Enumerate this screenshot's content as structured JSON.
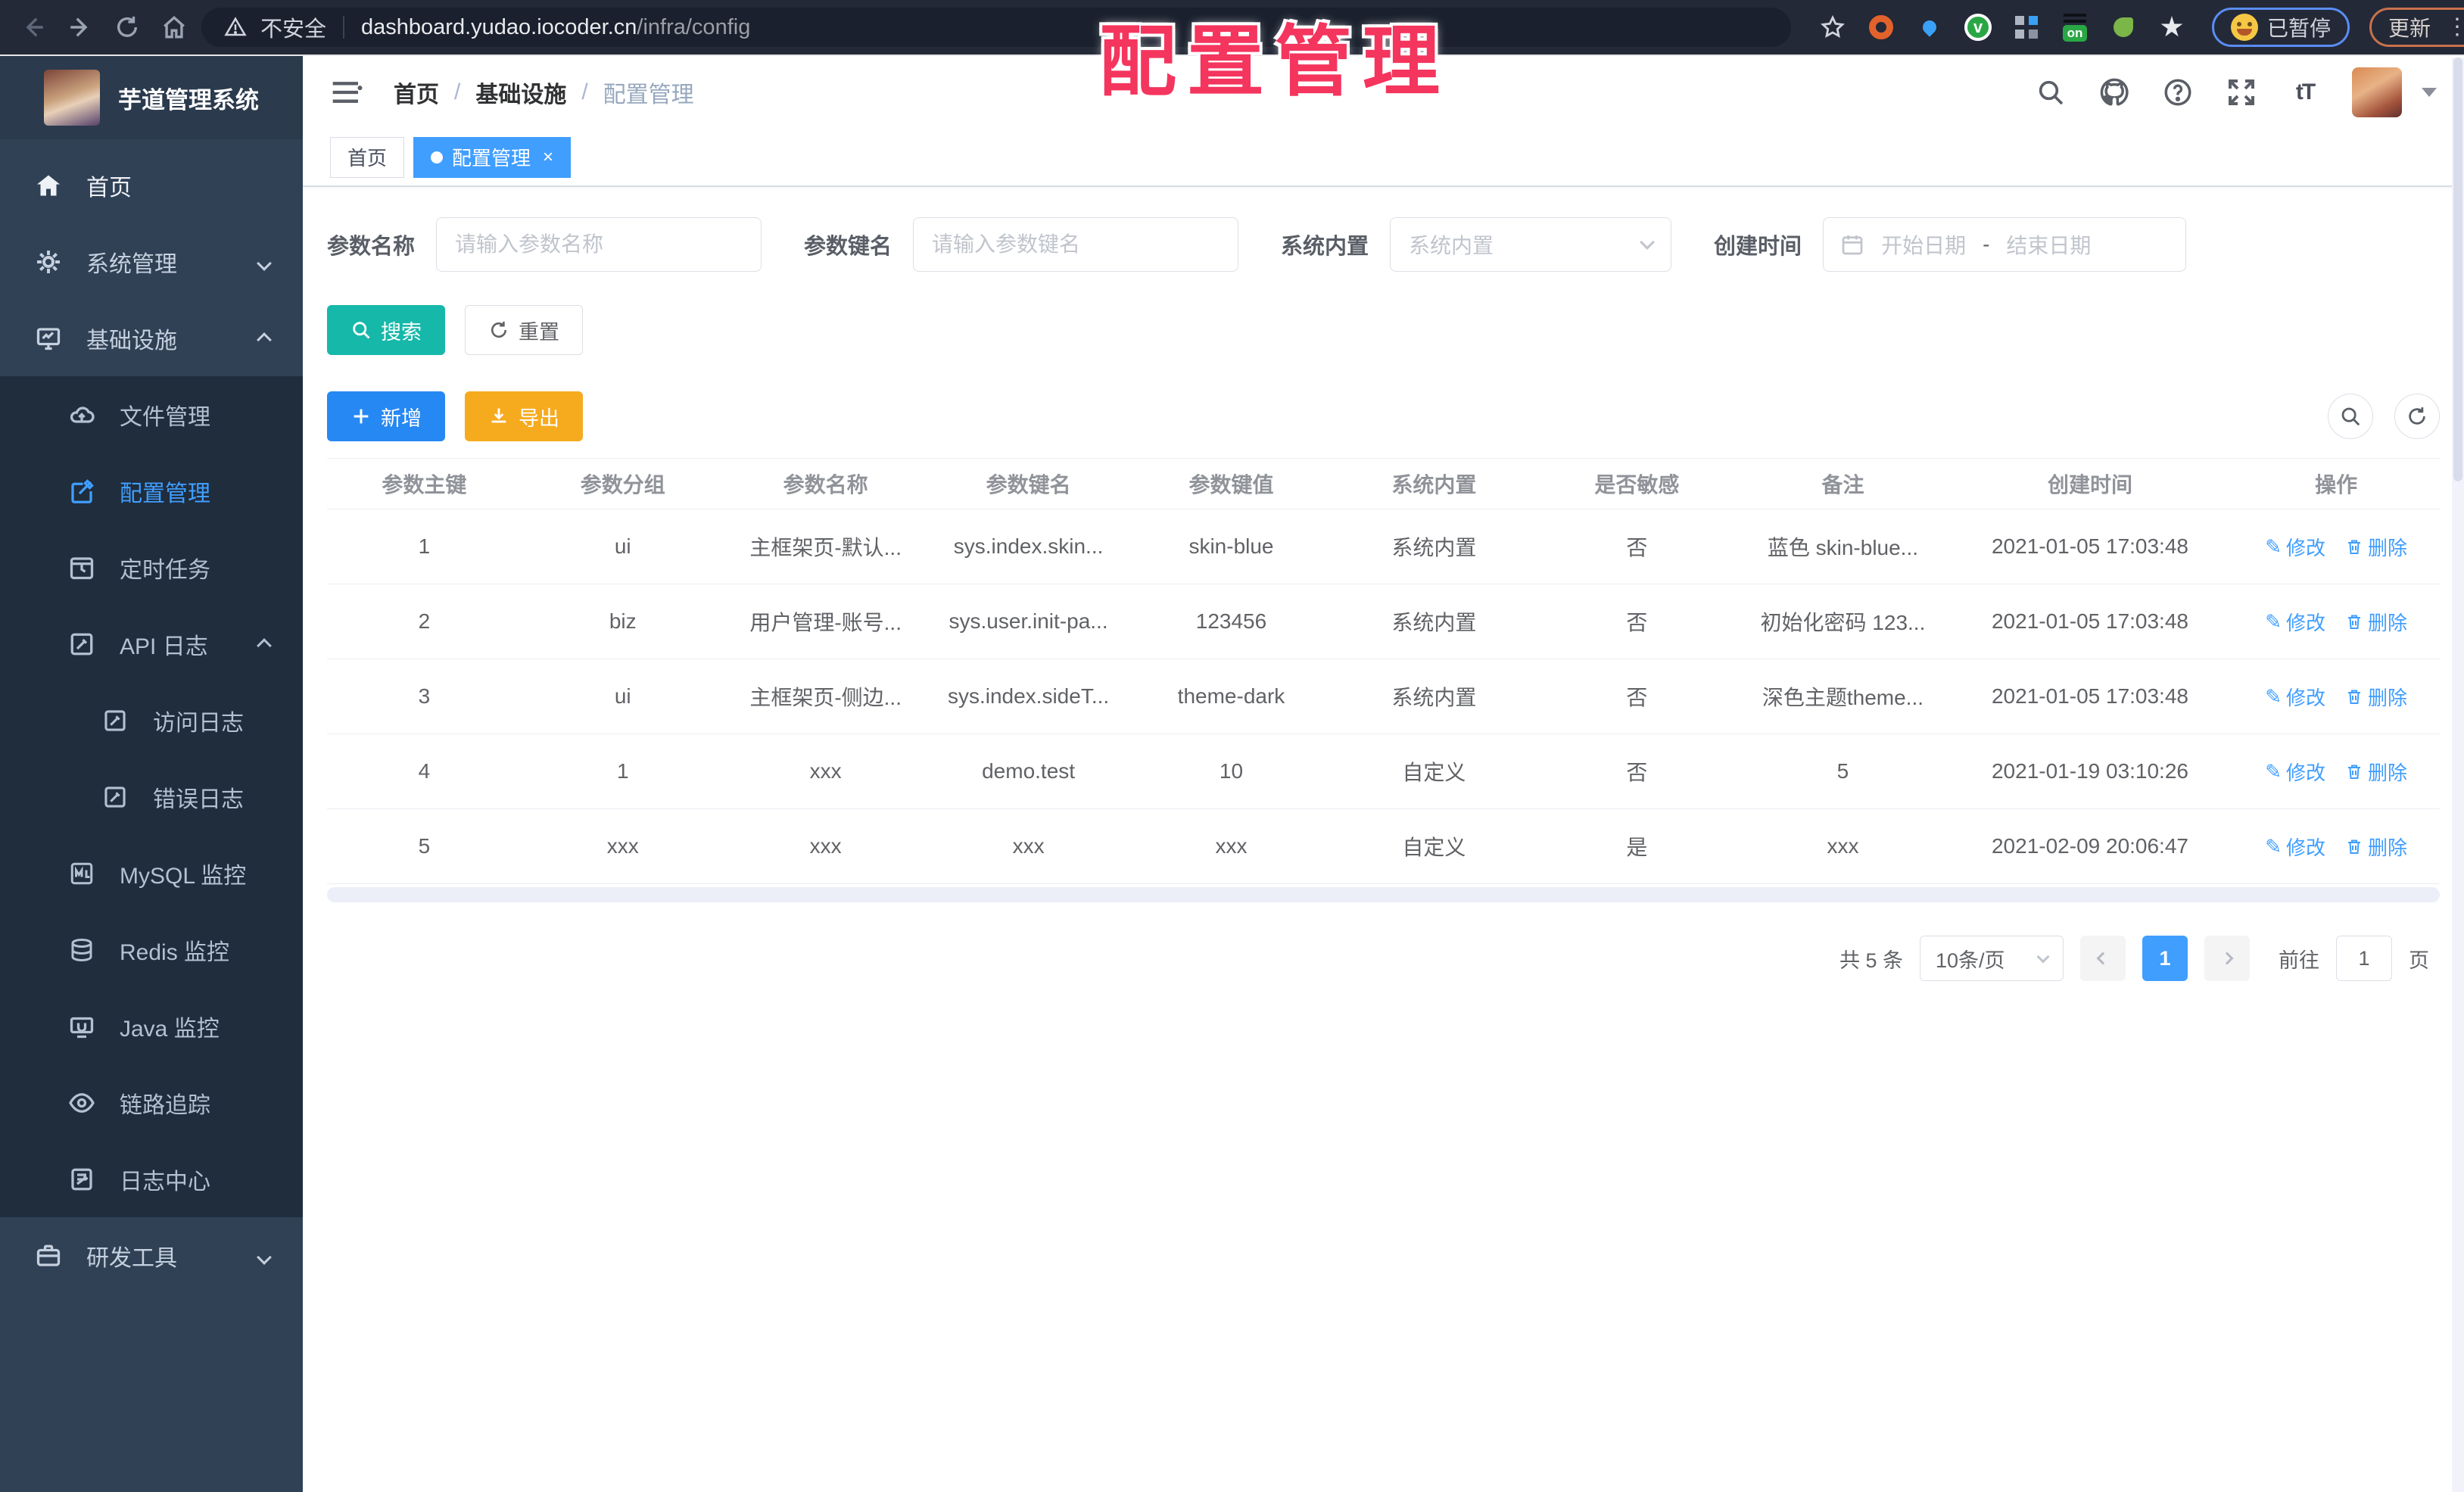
{
  "browser": {
    "security_label": "不安全",
    "url_host": "dashboard.yudao.iocoder.cn",
    "url_path": "/infra/config",
    "paused_badge": "已暂停",
    "update_button": "更新"
  },
  "overlay_title": "配置管理",
  "sidebar": {
    "app_title": "芋道管理系统",
    "items": [
      {
        "label": "首页"
      },
      {
        "label": "系统管理"
      },
      {
        "label": "基础设施"
      },
      {
        "label": "文件管理"
      },
      {
        "label": "配置管理"
      },
      {
        "label": "定时任务"
      },
      {
        "label": "API 日志"
      },
      {
        "label": "访问日志"
      },
      {
        "label": "错误日志"
      },
      {
        "label": "MySQL 监控"
      },
      {
        "label": "Redis 监控"
      },
      {
        "label": "Java 监控"
      },
      {
        "label": "链路追踪"
      },
      {
        "label": "日志中心"
      },
      {
        "label": "研发工具"
      }
    ]
  },
  "header": {
    "breadcrumb": [
      "首页",
      "基础设施",
      "配置管理"
    ]
  },
  "tabs": [
    {
      "label": "首页"
    },
    {
      "label": "配置管理",
      "close": "×"
    }
  ],
  "filters": {
    "name_label": "参数名称",
    "name_placeholder": "请输入参数名称",
    "key_label": "参数键名",
    "key_placeholder": "请输入参数键名",
    "builtin_label": "系统内置",
    "builtin_placeholder": "系统内置",
    "date_label": "创建时间",
    "date_start": "开始日期",
    "date_sep": "-",
    "date_end": "结束日期"
  },
  "toolbar": {
    "search": "搜索",
    "reset": "重置",
    "add": "新增",
    "export": "导出"
  },
  "table": {
    "columns": [
      "参数主键",
      "参数分组",
      "参数名称",
      "参数键名",
      "参数键值",
      "系统内置",
      "是否敏感",
      "备注",
      "创建时间",
      "操作"
    ],
    "rows": [
      {
        "id": "1",
        "group": "ui",
        "name": "主框架页-默认...",
        "key": "sys.index.skin...",
        "value": "skin-blue",
        "builtin": "系统内置",
        "sensitive": "否",
        "remark": "蓝色 skin-blue...",
        "created": "2021-01-05 17:03:48"
      },
      {
        "id": "2",
        "group": "biz",
        "name": "用户管理-账号...",
        "key": "sys.user.init-pa...",
        "value": "123456",
        "builtin": "系统内置",
        "sensitive": "否",
        "remark": "初始化密码 123...",
        "created": "2021-01-05 17:03:48"
      },
      {
        "id": "3",
        "group": "ui",
        "name": "主框架页-侧边...",
        "key": "sys.index.sideT...",
        "value": "theme-dark",
        "builtin": "系统内置",
        "sensitive": "否",
        "remark": "深色主题theme...",
        "created": "2021-01-05 17:03:48"
      },
      {
        "id": "4",
        "group": "1",
        "name": "xxx",
        "key": "demo.test",
        "value": "10",
        "builtin": "自定义",
        "sensitive": "否",
        "remark": "5",
        "created": "2021-01-19 03:10:26"
      },
      {
        "id": "5",
        "group": "xxx",
        "name": "xxx",
        "key": "xxx",
        "value": "xxx",
        "builtin": "自定义",
        "sensitive": "是",
        "remark": "xxx",
        "created": "2021-02-09 20:06:47"
      }
    ],
    "actions": {
      "edit": "修改",
      "delete": "删除"
    }
  },
  "pagination": {
    "total": "共 5 条",
    "page_size": "10条/页",
    "current": "1",
    "goto_label": "前往",
    "goto_value": "1",
    "page_label": "页"
  }
}
